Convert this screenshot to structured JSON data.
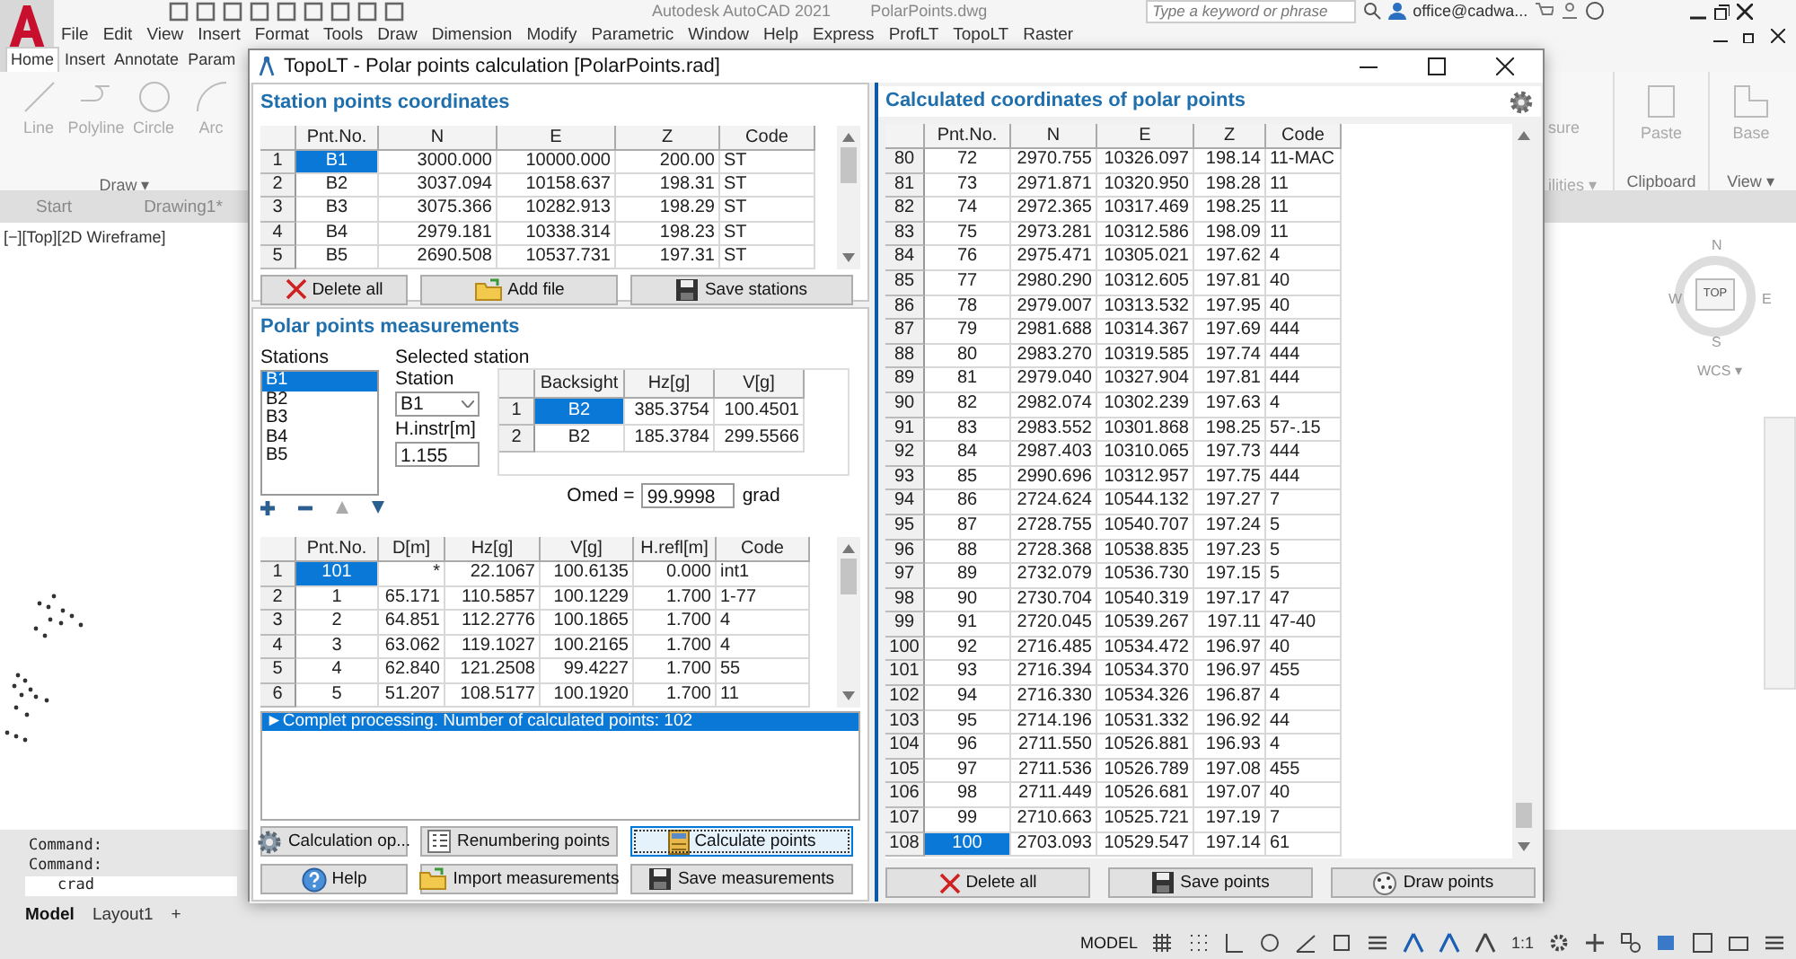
{
  "app": {
    "title": "Autodesk AutoCAD 2021",
    "file": "PolarPoints.dwg",
    "search_placeholder": "Type a keyword or phrase",
    "user": "office@cadwa..."
  },
  "menu": [
    "File",
    "Edit",
    "View",
    "Insert",
    "Format",
    "Tools",
    "Draw",
    "Dimension",
    "Modify",
    "Parametric",
    "Window",
    "Help",
    "Express",
    "ProfLT",
    "TopoLT",
    "Raster"
  ],
  "ribbon_tabs": [
    {
      "label": "Home",
      "selected": true
    },
    {
      "label": "Insert",
      "selected": false
    },
    {
      "label": "Annotate",
      "selected": false
    },
    {
      "label": "Param",
      "selected": false
    }
  ],
  "ribbon_tools": [
    {
      "label": "Line",
      "kind": "line"
    },
    {
      "label": "Polyline",
      "kind": "polyline"
    },
    {
      "label": "Circle",
      "kind": "circle"
    },
    {
      "label": "Arc",
      "kind": "arc"
    }
  ],
  "ribbon_panel": "Draw ▾",
  "ribbon_right": {
    "measure": "sure",
    "utilities": "ilities ▾",
    "paste": "Paste",
    "clipboard": "Clipboard",
    "base": "Base",
    "view": "View ▾"
  },
  "doc_tabs": [
    "Start",
    "Drawing1*"
  ],
  "viewport_label": "[−][Top][2D Wireframe]",
  "viewcube": {
    "north": "N",
    "south": "S",
    "east": "E",
    "west": "W",
    "face": "TOP",
    "ucs": "WCS ▾"
  },
  "command_lines": [
    "Command:",
    "Command:"
  ],
  "command_input": "crad",
  "layout_tabs": [
    {
      "label": "Model",
      "selected": true
    },
    {
      "label": "Layout1",
      "selected": false
    }
  ],
  "add_tab": "+",
  "status_bar": {
    "model": "MODEL",
    "scale": "1:1"
  },
  "dialog": {
    "title": "TopoLT - Polar points calculation [PolarPoints.rad]",
    "stations_section": {
      "title": "Station points coordinates",
      "columns": [
        "Pnt.No.",
        "N",
        "E",
        "Z",
        "Code"
      ],
      "rows": [
        {
          "no": "1",
          "cells": [
            "B1",
            "3000.000",
            "10000.000",
            "200.00",
            "ST"
          ],
          "selected": true
        },
        {
          "no": "2",
          "cells": [
            "B2",
            "3037.094",
            "10158.637",
            "198.31",
            "ST"
          ],
          "selected": false
        },
        {
          "no": "3",
          "cells": [
            "B3",
            "3075.366",
            "10282.913",
            "198.29",
            "ST"
          ],
          "selected": false
        },
        {
          "no": "4",
          "cells": [
            "B4",
            "2979.181",
            "10338.314",
            "198.23",
            "ST"
          ],
          "selected": false
        },
        {
          "no": "5",
          "cells": [
            "B5",
            "2690.508",
            "10537.731",
            "197.31",
            "ST"
          ],
          "selected": false
        }
      ],
      "buttons": [
        {
          "label": "Delete all",
          "kind": "delete"
        },
        {
          "label": "Add file",
          "kind": "folder"
        },
        {
          "label": "Save stations",
          "kind": "save"
        }
      ]
    },
    "measurements_section": {
      "title": "Polar points measurements",
      "stations_label": "Stations",
      "stations": [
        {
          "label": "B1",
          "selected": true
        },
        {
          "label": "B2",
          "selected": false
        },
        {
          "label": "B3",
          "selected": false
        },
        {
          "label": "B4",
          "selected": false
        },
        {
          "label": "B5",
          "selected": false
        }
      ],
      "selected_station_label": "Selected station",
      "station_label": "Station",
      "station_value": "B1",
      "hinstr_label": "H.instr[m]",
      "hinstr_value": "1.155",
      "backsight": {
        "columns": [
          "Backsight",
          "Hz[g]",
          "V[g]"
        ],
        "rows": [
          {
            "no": "1",
            "cells": [
              "B2",
              "385.3754",
              "100.4501"
            ],
            "selected": true
          },
          {
            "no": "2",
            "cells": [
              "B2",
              "185.3784",
              "299.5566"
            ],
            "selected": false
          }
        ]
      },
      "omed_label": "Omed =",
      "omed_value": "99.9998",
      "omed_unit": "grad",
      "table": {
        "columns": [
          "Pnt.No.",
          "D[m]",
          "Hz[g]",
          "V[g]",
          "H.refl[m]",
          "Code"
        ],
        "rows": [
          {
            "no": "1",
            "cells": [
              "101",
              "*",
              "22.1067",
              "100.6135",
              "0.000",
              "int1"
            ],
            "selected": true
          },
          {
            "no": "2",
            "cells": [
              "1",
              "65.171",
              "110.5857",
              "100.1229",
              "1.700",
              "1-77"
            ],
            "selected": false
          },
          {
            "no": "3",
            "cells": [
              "2",
              "64.851",
              "112.2776",
              "100.1865",
              "1.700",
              "4"
            ],
            "selected": false
          },
          {
            "no": "4",
            "cells": [
              "3",
              "63.062",
              "119.1027",
              "100.2165",
              "1.700",
              "4"
            ],
            "selected": false
          },
          {
            "no": "5",
            "cells": [
              "4",
              "62.840",
              "121.2508",
              "99.4227",
              "1.700",
              "55"
            ],
            "selected": false
          },
          {
            "no": "6",
            "cells": [
              "5",
              "51.207",
              "108.5177",
              "100.1920",
              "1.700",
              "11"
            ],
            "selected": false
          }
        ]
      },
      "log": [
        {
          "text": "►Complet processing. Number of calculated points: 102",
          "selected": true
        }
      ],
      "buttons": [
        {
          "label": "Calculation op...",
          "kind": "gear"
        },
        {
          "label": "Renumbering points",
          "kind": "renumber"
        },
        {
          "label": "Calculate points",
          "kind": "calculator"
        },
        {
          "label": "Help",
          "kind": "help"
        },
        {
          "label": "Import measurements",
          "kind": "folder"
        },
        {
          "label": "Save measurements",
          "kind": "save"
        }
      ]
    },
    "results_section": {
      "title": "Calculated coordinates of polar points",
      "columns": [
        "Pnt.No.",
        "N",
        "E",
        "Z",
        "Code"
      ],
      "rows": [
        {
          "no": "80",
          "cells": [
            "72",
            "2970.755",
            "10326.097",
            "198.14",
            "11-MAC"
          ],
          "selected": false
        },
        {
          "no": "81",
          "cells": [
            "73",
            "2971.871",
            "10320.950",
            "198.28",
            "11"
          ],
          "selected": false
        },
        {
          "no": "82",
          "cells": [
            "74",
            "2972.365",
            "10317.469",
            "198.25",
            "11"
          ],
          "selected": false
        },
        {
          "no": "83",
          "cells": [
            "75",
            "2973.281",
            "10312.586",
            "198.09",
            "11"
          ],
          "selected": false
        },
        {
          "no": "84",
          "cells": [
            "76",
            "2975.471",
            "10305.021",
            "197.62",
            "4"
          ],
          "selected": false
        },
        {
          "no": "85",
          "cells": [
            "77",
            "2980.290",
            "10312.605",
            "197.81",
            "40"
          ],
          "selected": false
        },
        {
          "no": "86",
          "cells": [
            "78",
            "2979.007",
            "10313.532",
            "197.95",
            "40"
          ],
          "selected": false
        },
        {
          "no": "87",
          "cells": [
            "79",
            "2981.688",
            "10314.367",
            "197.69",
            "444"
          ],
          "selected": false
        },
        {
          "no": "88",
          "cells": [
            "80",
            "2983.270",
            "10319.585",
            "197.74",
            "444"
          ],
          "selected": false
        },
        {
          "no": "89",
          "cells": [
            "81",
            "2979.040",
            "10327.904",
            "197.81",
            "444"
          ],
          "selected": false
        },
        {
          "no": "90",
          "cells": [
            "82",
            "2982.074",
            "10302.239",
            "197.63",
            "4"
          ],
          "selected": false
        },
        {
          "no": "91",
          "cells": [
            "83",
            "2983.552",
            "10301.868",
            "198.25",
            "57-.15"
          ],
          "selected": false
        },
        {
          "no": "92",
          "cells": [
            "84",
            "2987.403",
            "10310.065",
            "197.73",
            "444"
          ],
          "selected": false
        },
        {
          "no": "93",
          "cells": [
            "85",
            "2990.696",
            "10312.957",
            "197.75",
            "444"
          ],
          "selected": false
        },
        {
          "no": "94",
          "cells": [
            "86",
            "2724.624",
            "10544.132",
            "197.27",
            "7"
          ],
          "selected": false
        },
        {
          "no": "95",
          "cells": [
            "87",
            "2728.755",
            "10540.707",
            "197.24",
            "5"
          ],
          "selected": false
        },
        {
          "no": "96",
          "cells": [
            "88",
            "2728.368",
            "10538.835",
            "197.23",
            "5"
          ],
          "selected": false
        },
        {
          "no": "97",
          "cells": [
            "89",
            "2732.079",
            "10536.730",
            "197.15",
            "5"
          ],
          "selected": false
        },
        {
          "no": "98",
          "cells": [
            "90",
            "2730.704",
            "10540.319",
            "197.17",
            "47"
          ],
          "selected": false
        },
        {
          "no": "99",
          "cells": [
            "91",
            "2720.045",
            "10539.267",
            "197.11",
            "47-40"
          ],
          "selected": false
        },
        {
          "no": "100",
          "cells": [
            "92",
            "2716.485",
            "10534.472",
            "196.97",
            "40"
          ],
          "selected": false
        },
        {
          "no": "101",
          "cells": [
            "93",
            "2716.394",
            "10534.370",
            "196.97",
            "455"
          ],
          "selected": false
        },
        {
          "no": "102",
          "cells": [
            "94",
            "2716.330",
            "10534.326",
            "196.87",
            "4"
          ],
          "selected": false
        },
        {
          "no": "103",
          "cells": [
            "95",
            "2714.196",
            "10531.332",
            "196.92",
            "44"
          ],
          "selected": false
        },
        {
          "no": "104",
          "cells": [
            "96",
            "2711.550",
            "10526.881",
            "196.93",
            "4"
          ],
          "selected": false
        },
        {
          "no": "105",
          "cells": [
            "97",
            "2711.536",
            "10526.789",
            "197.08",
            "455"
          ],
          "selected": false
        },
        {
          "no": "106",
          "cells": [
            "98",
            "2711.449",
            "10526.681",
            "197.07",
            "40"
          ],
          "selected": false
        },
        {
          "no": "107",
          "cells": [
            "99",
            "2710.663",
            "10525.721",
            "197.19",
            "7"
          ],
          "selected": false
        },
        {
          "no": "108",
          "cells": [
            "100",
            "2703.093",
            "10529.547",
            "197.14",
            "61"
          ],
          "selected": true
        }
      ],
      "buttons": [
        {
          "label": "Delete all",
          "kind": "delete"
        },
        {
          "label": "Save points",
          "kind": "save"
        },
        {
          "label": "Draw points",
          "kind": "draw"
        }
      ]
    }
  }
}
